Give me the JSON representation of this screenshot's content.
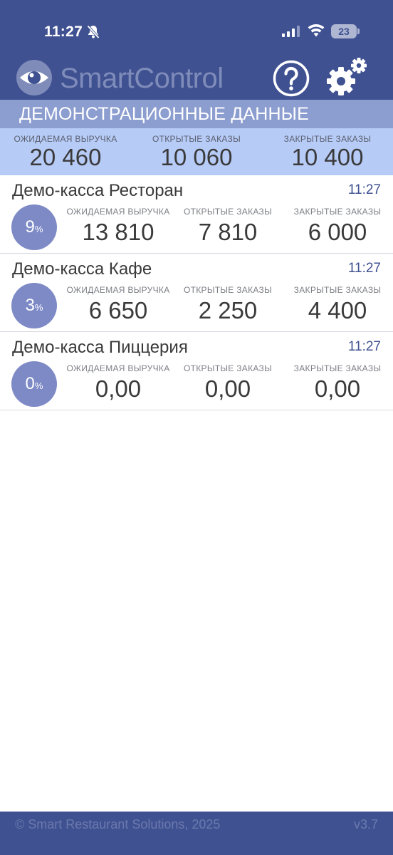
{
  "status_bar": {
    "time": "11:27",
    "battery": "23"
  },
  "header": {
    "title_smart": "Smart",
    "title_control": "Control"
  },
  "banner": {
    "text": "ДЕМОНСТРАЦИОННЫЕ ДАННЫЕ"
  },
  "summary": {
    "expected_label": "ОЖИДАЕМАЯ ВЫРУЧКА",
    "expected_value": "20 460",
    "open_label": "ОТКРЫТЫЕ ЗАКАЗЫ",
    "open_value": "10 060",
    "closed_label": "ЗАКРЫТЫЕ ЗАКАЗЫ",
    "closed_value": "10 400"
  },
  "stores": [
    {
      "name": "Демо-касса Ресторан",
      "time": "11:27",
      "percent": "9",
      "percent_sign": "%",
      "expected_label": "ОЖИДАЕМАЯ ВЫРУЧКА",
      "expected": "13 810",
      "open_label": "ОТКРЫТЫЕ ЗАКАЗЫ",
      "open": "7 810",
      "closed_label": "ЗАКРЫТЫЕ ЗАКАЗЫ",
      "closed": "6 000"
    },
    {
      "name": "Демо-касса Кафе",
      "time": "11:27",
      "percent": "3",
      "percent_sign": "%",
      "expected_label": "ОЖИДАЕМАЯ ВЫРУЧКА",
      "expected": "6 650",
      "open_label": "ОТКРЫТЫЕ ЗАКАЗЫ",
      "open": "2 250",
      "closed_label": "ЗАКРЫТЫЕ ЗАКАЗЫ",
      "closed": "4 400"
    },
    {
      "name": "Демо-касса Пиццерия",
      "time": "11:27",
      "percent": "0",
      "percent_sign": "%",
      "expected_label": "ОЖИДАЕМАЯ ВЫРУЧКА",
      "expected": "0,00",
      "open_label": "ОТКРЫТЫЕ ЗАКАЗЫ",
      "open": "0,00",
      "closed_label": "ЗАКРЫТЫЕ ЗАКАЗЫ",
      "closed": "0,00"
    }
  ],
  "footer": {
    "copyright": "© Smart Restaurant Solutions, 2025",
    "version": "v3.7"
  },
  "icons": {
    "bell": "bell-slash-icon",
    "signal": "cellular-signal-icon",
    "wifi": "wifi-icon",
    "logo": "eye-icon",
    "help": "question-circle-icon",
    "settings": "gears-icon"
  },
  "colors": {
    "header": "#3f5191",
    "banner": "#8c9dd0",
    "summary": "#b7cbf7",
    "percent_circle": "#7d8ac6",
    "time_accent": "#3f5191"
  }
}
